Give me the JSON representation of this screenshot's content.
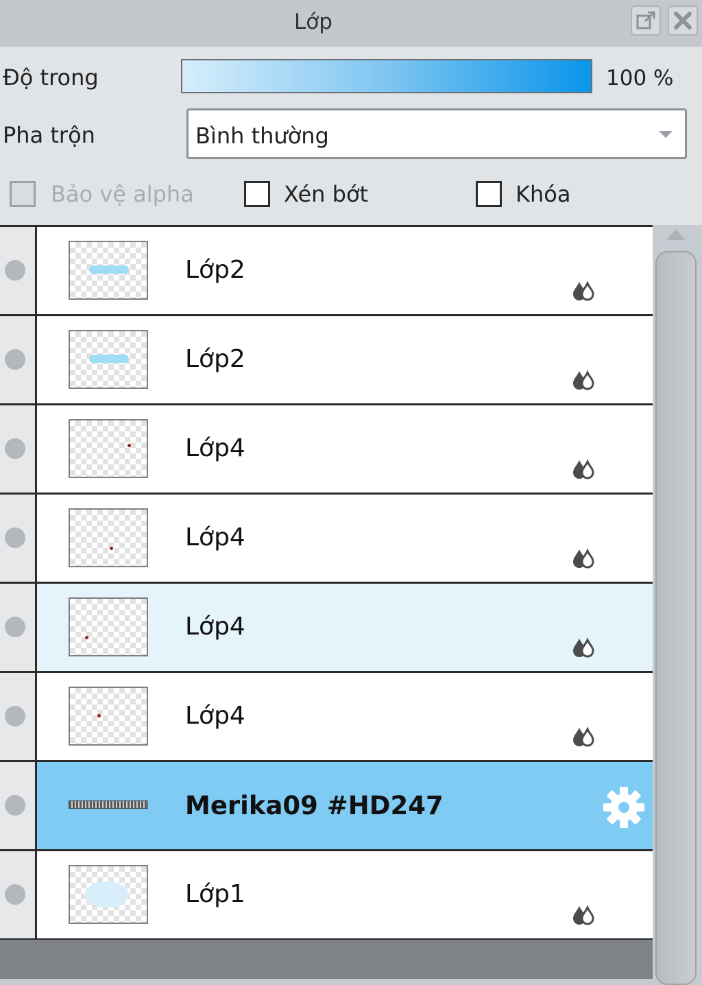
{
  "panel": {
    "title": "Lớp",
    "opacity_label": "Độ trong",
    "opacity_value": "100 %",
    "opacity_fraction": 1.0,
    "blend_label": "Pha trộn",
    "blend_value": "Bình thường",
    "checkboxes": {
      "protect_alpha": {
        "label": "Bảo vệ alpha",
        "checked": false,
        "enabled": false
      },
      "clip": {
        "label": "Xén bớt",
        "checked": false,
        "enabled": true
      },
      "lock": {
        "label": "Khóa",
        "checked": false,
        "enabled": true
      }
    }
  },
  "layers": [
    {
      "name": "Lớp2",
      "state": "normal",
      "thumb": "cyan-text"
    },
    {
      "name": "Lớp2",
      "state": "normal",
      "thumb": "cyan-text"
    },
    {
      "name": "Lớp4",
      "state": "normal",
      "thumb": "red-dot"
    },
    {
      "name": "Lớp4",
      "state": "normal",
      "thumb": "red-dot"
    },
    {
      "name": "Lớp4",
      "state": "hover",
      "thumb": "red-dot"
    },
    {
      "name": "Lớp4",
      "state": "normal",
      "thumb": "red-dot"
    },
    {
      "name": "Merika09 #HD247",
      "state": "selected",
      "thumb": "text-strip"
    },
    {
      "name": "Lớp1",
      "state": "normal",
      "thumb": "light-blob"
    }
  ],
  "icons": {
    "popout": "popout-icon",
    "close": "close-icon",
    "drops": "ink-drops-icon",
    "gear": "gear-icon"
  },
  "colors": {
    "selected_row": "#80cbf4",
    "hover_row": "#e5f3fb",
    "opacity_bar_end": "#0a95ea"
  }
}
